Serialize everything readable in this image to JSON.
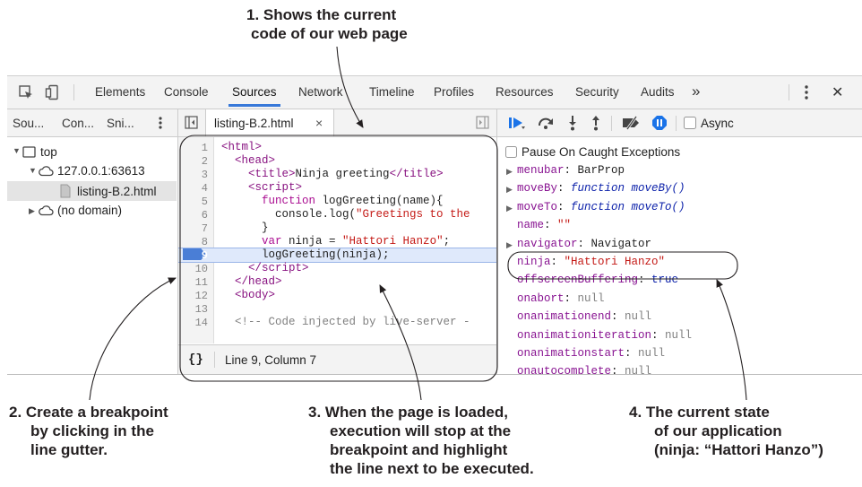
{
  "callouts": {
    "c1": [
      "1. Shows the current",
      "code of our web page"
    ],
    "c2": [
      "2. Create a breakpoint",
      "by clicking in the",
      "line gutter."
    ],
    "c3": [
      "3. When the page is loaded,",
      "execution will stop at the",
      "breakpoint and highlight",
      "the line next to be executed."
    ],
    "c4": [
      "4. The current state",
      "of our application",
      "(ninja: “Hattori Hanzo”)"
    ]
  },
  "toolbar": {
    "tabs": [
      "Elements",
      "Console",
      "Sources",
      "Network",
      "Timeline",
      "Profiles",
      "Resources",
      "Security",
      "Audits"
    ],
    "active_tab": "Sources",
    "overflow": "»",
    "close": "✕"
  },
  "navigator": {
    "tabs": [
      "Sou...",
      "Con...",
      "Sni..."
    ],
    "tree": [
      "top",
      "127.0.0.1:63613",
      "listing-B.2.html",
      "(no domain)"
    ]
  },
  "editor": {
    "file_tab": "listing-B.2.html",
    "line_numbers": [
      "1",
      "2",
      "3",
      "4",
      "5",
      "6",
      "7",
      "8",
      "9",
      "10",
      "11",
      "12",
      "13",
      "14"
    ],
    "breakpoint_line": 9,
    "status": "Line 9, Column 7",
    "format_icon": "{}"
  },
  "debugger": {
    "async_label": "Async",
    "pause_label": "Pause On Caught Exceptions",
    "scope": [
      {
        "key": "menubar",
        "value": "BarProp",
        "type": "obj",
        "expandable": true
      },
      {
        "key": "moveBy",
        "value": "function moveBy()",
        "type": "fn",
        "expandable": true
      },
      {
        "key": "moveTo",
        "value": "function moveTo()",
        "type": "fn",
        "expandable": true
      },
      {
        "key": "name",
        "value": "\"\"",
        "type": "str",
        "expandable": false
      },
      {
        "key": "navigator",
        "value": "Navigator",
        "type": "obj",
        "expandable": true
      },
      {
        "key": "ninja",
        "value": "\"Hattori Hanzo\"",
        "type": "str",
        "expandable": false
      },
      {
        "key": "offscreenBuffering",
        "value": "true",
        "type": "bool",
        "expandable": false
      },
      {
        "key": "onabort",
        "value": "null",
        "type": "null",
        "expandable": false
      },
      {
        "key": "onanimationend",
        "value": "null",
        "type": "null",
        "expandable": false
      },
      {
        "key": "onanimationiteration",
        "value": "null",
        "type": "null",
        "expandable": false
      },
      {
        "key": "onanimationstart",
        "value": "null",
        "type": "null",
        "expandable": false
      },
      {
        "key": "onautocomplete",
        "value": "null",
        "type": "null",
        "expandable": false
      }
    ]
  },
  "colors": {
    "accent": "#3879d9",
    "breakpoint": "#4a7ed6",
    "highlight": "#dfe9fb",
    "pause_icon": "#1a73e8"
  }
}
